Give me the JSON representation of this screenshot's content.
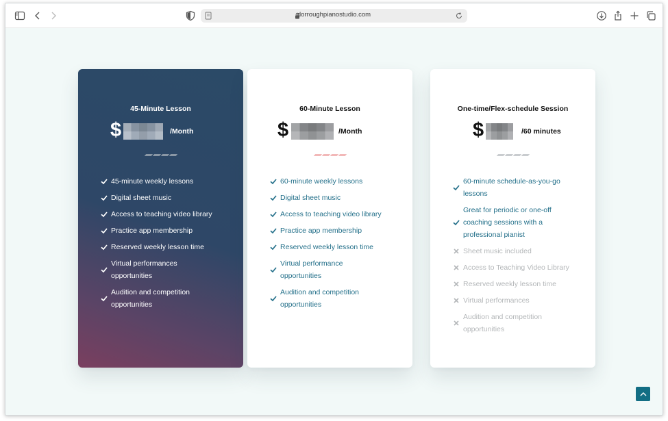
{
  "browser": {
    "url": "dorroughpianostudio.com"
  },
  "cards": [
    {
      "title": "45-Minute Lesson",
      "currency": "$",
      "period": "/Month",
      "features": [
        {
          "text": "45-minute weekly lessons",
          "included": true
        },
        {
          "text": "Digital sheet music",
          "included": true
        },
        {
          "text": "Access to teaching video library",
          "included": true
        },
        {
          "text": "Practice app membership",
          "included": true
        },
        {
          "text": "Reserved weekly lesson time",
          "included": true
        },
        {
          "text": "Virtual performances opportunities",
          "included": true
        },
        {
          "text": "Audition and competition opportunities",
          "included": true
        }
      ]
    },
    {
      "title": "60-Minute Lesson",
      "currency": "$",
      "period": "/Month",
      "features": [
        {
          "text": "60-minute weekly lessons",
          "included": true
        },
        {
          "text": "Digital sheet music",
          "included": true
        },
        {
          "text": "Access to teaching video library",
          "included": true
        },
        {
          "text": "Practice app membership",
          "included": true
        },
        {
          "text": "Reserved weekly lesson time",
          "included": true
        },
        {
          "text": "Virtual performance opportunities",
          "included": true
        },
        {
          "text": "Audition and competition opportunities",
          "included": true
        }
      ]
    },
    {
      "title": "One-time/Flex-schedule Session",
      "currency": "$",
      "period": "/60 minutes",
      "features": [
        {
          "text": "60-minute schedule-as-you-go lessons",
          "included": true
        },
        {
          "text": "Great for periodic or one-off coaching sessions with a professional pianist",
          "included": true
        },
        {
          "text": "Sheet music included",
          "included": false
        },
        {
          "text": "Access to Teaching Video Library",
          "included": false
        },
        {
          "text": "Reserved weekly lesson time",
          "included": false
        },
        {
          "text": "Virtual performances",
          "included": false
        },
        {
          "text": "Audition and competition opportunities",
          "included": false
        }
      ]
    }
  ],
  "colors": {
    "accent": "#24708a",
    "check_featured": "#ffffff",
    "muted": "#b4b7b9",
    "dash_featured": "#8a97a5",
    "dash_pink": "#f2b8b8",
    "dash_gray": "#c9cccf",
    "scroll_top_bg": "#136e84"
  },
  "icons": {
    "sidebar": "sidebar-icon",
    "back": "chevron-left-icon",
    "forward": "chevron-right-icon",
    "privacy": "shield-icon",
    "download": "download-icon",
    "share": "share-icon",
    "new_tab": "plus-icon",
    "tabs": "tabs-overview-icon",
    "scroll_top": "chevron-up-icon"
  }
}
